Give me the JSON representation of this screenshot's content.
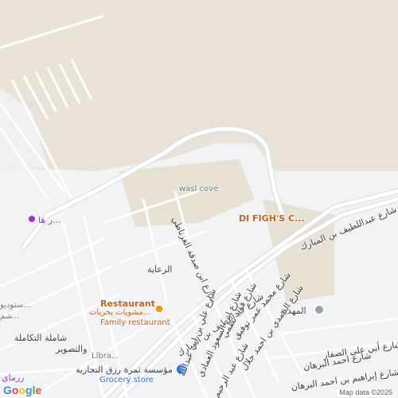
{
  "map": {
    "colors": {
      "land": "#e8e3d6",
      "urban": "#f1f3f4",
      "road": "#ffffff",
      "road_casing": "#d7dbe0",
      "poi_orange": "#c5611e",
      "purple": "#9334e6"
    },
    "labels": {
      "lbl_1": "wasl cove",
      "lbl_2": "شارع ابن صدقة الغرناطي",
      "lbl_3": "DI FIGH'S C...",
      "lbl_4": "شارع عبداللطيف بن المبارك",
      "lbl_5": "شارع عبداللطيف بن المبارك",
      "lbl_6": "الرعاية",
      "lbl_7": "ر ها...",
      "lbl_8": "ستوديو...",
      "lbl_9": "شارع محمد عمر توفيق",
      "lbl_10": "شارع فؤاد نظمي",
      "lbl_11": "شارع الحمدي بن احمد جلال",
      "lbl_12": "المهدية",
      "lbl_13": "شارع أبي علي الصفار",
      "lbl_14": "شارع احمد البرهان",
      "lbl_15": "شارع إبراهيم بن احمد البرهان",
      "lbl_16": "شارع ابن السعود العمادي",
      "lbl_17": "شارع علي بن ابي عبدالله",
      "lbl_18": "شارع عبد الرحيم",
      "lbl_19": "شاملة التكاملة",
      "lbl_20": "والتصوير",
      "lbl_21": "Libra...",
      "lbl_22": "ررماي",
      "lbl_23": "شم..."
    },
    "pois": {
      "restaurant_name": "Restaurant",
      "restaurant_arabic": "مشويات بحريات...",
      "restaurant_category": "Family restaurant",
      "grocery_name": "مؤسسة ثمرة رزق التجارية",
      "grocery_category": "Grocery store"
    },
    "attribution": {
      "logo": "Google",
      "map_data": "Map data ©2025"
    }
  }
}
